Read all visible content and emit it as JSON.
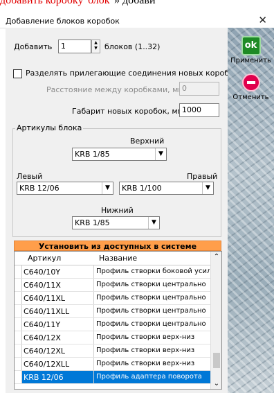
{
  "context_text": {
    "red": "добавить коробку\"блок\"",
    "black": "» добави"
  },
  "window": {
    "title": "Добавление блоков коробок",
    "close_glyph": "✕"
  },
  "add": {
    "label": "Добавить",
    "value": "1",
    "suffix": "блоков (1..32)"
  },
  "separate": {
    "label": "Разделять прилегающие соединения новых коробок",
    "checked": false
  },
  "distance": {
    "label": "Расстояние между коробками, мм",
    "value": "0"
  },
  "size": {
    "label": "Габарит новых коробок, мм",
    "value": "1000"
  },
  "articles": {
    "legend": "Артикулы блока",
    "top": {
      "label": "Верхний",
      "value": "KRB 1/85"
    },
    "left": {
      "label": "Левый",
      "value": "KRB 12/06"
    },
    "right": {
      "label": "Правый",
      "value": "KRB 1/100"
    },
    "bottom": {
      "label": "Нижний",
      "value": "KRB 1/85"
    }
  },
  "install_button": "Установить из доступных в системе",
  "table": {
    "headers": [
      "Артикул",
      "Название"
    ],
    "rows": [
      [
        "C640/10Y",
        "Профиль створки боковой усилен"
      ],
      [
        "C640/11X",
        "Профиль створки центрально"
      ],
      [
        "C640/11XL",
        "Профиль створки центрально"
      ],
      [
        "C640/11XLL",
        "Профиль створки центрально"
      ],
      [
        "C640/11Y",
        "Профиль створки центрально"
      ],
      [
        "C640/12X",
        "Профиль створки верх-низ"
      ],
      [
        "C640/12XL",
        "Профиль створки верх-низ"
      ],
      [
        "C640/12XLL",
        "Профиль створки верх-низ"
      ],
      [
        "KRB 12/06",
        "Профиль адаптера поворота"
      ]
    ],
    "selected_index": 8
  },
  "actions": {
    "apply": {
      "icon_text": "ok",
      "label": "Применить"
    },
    "cancel": {
      "label": "Отменить"
    }
  },
  "colors": {
    "install_bar": "#ff9e4a",
    "selection": "#0078d7",
    "apply_icon": "#1e8a25",
    "cancel_icon": "#e0004d"
  }
}
